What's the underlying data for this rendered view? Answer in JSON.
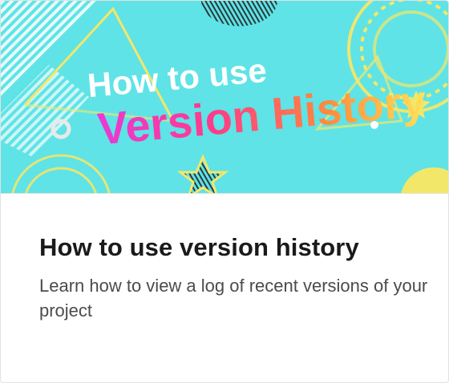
{
  "hero": {
    "line1": "How to use",
    "line2": "Version History"
  },
  "card": {
    "title": "How to use version history",
    "description": "Learn how to view a log of recent versions of your project"
  },
  "colors": {
    "hero_bg": "#5fe3e6",
    "accent_yellow": "#f3e76a",
    "accent_white": "#ffffff",
    "title_text": "#1a1a1a",
    "desc_text": "#4b4b4b"
  }
}
